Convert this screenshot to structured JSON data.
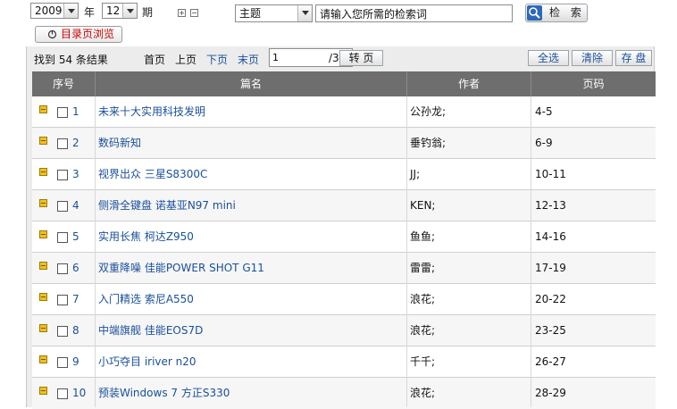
{
  "top": {
    "year_value": "2009",
    "year_unit": "年",
    "issue_value": "12",
    "issue_unit": "期",
    "expand_symbol": "+",
    "collapse_symbol": "−",
    "field_value": "主题",
    "search_placeholder": "请输入您所需的检索词",
    "search_label": "检 索",
    "catalog_label": "目录页浏览"
  },
  "nav": {
    "result_text": "找到 54 条结果",
    "first": "首页",
    "prev": "上页",
    "next": "下页",
    "last": "末页",
    "page_value": "1",
    "total": "/3",
    "go": "转 页",
    "select_all": "全选",
    "clear": "清除",
    "save": "存 盘"
  },
  "table": {
    "headers": {
      "index": "序号",
      "title": "篇名",
      "author": "作者",
      "pages": "页码"
    },
    "rows": [
      {
        "index": "1",
        "title": "未来十大实用科技发明",
        "author": "公孙龙;",
        "pages": "4-5"
      },
      {
        "index": "2",
        "title": "数码新知",
        "author": "垂钓翁;",
        "pages": "6-9"
      },
      {
        "index": "3",
        "title": "视界出众 三星S8300C",
        "author": "JJ;",
        "pages": "10-11"
      },
      {
        "index": "4",
        "title": "侧滑全键盘 诺基亚N97 mini",
        "author": "KEN;",
        "pages": "12-13"
      },
      {
        "index": "5",
        "title": "实用长焦 柯达Z950",
        "author": "鱼鱼;",
        "pages": "14-16"
      },
      {
        "index": "6",
        "title": "双重降噪 佳能POWER SHOT G11",
        "author": "雷雷;",
        "pages": "17-19"
      },
      {
        "index": "7",
        "title": "入门精选 索尼A550",
        "author": "浪花;",
        "pages": "20-22"
      },
      {
        "index": "8",
        "title": "中端旗舰 佳能EOS7D",
        "author": "浪花;",
        "pages": "23-25"
      },
      {
        "index": "9",
        "title": "小巧夺目 iriver n20",
        "author": "千千;",
        "pages": "26-27"
      },
      {
        "index": "10",
        "title": "预装Windows 7 方正S330",
        "author": "浪花;",
        "pages": "28-29"
      }
    ]
  },
  "colors": {
    "link": "#1a4f9c",
    "header_bg": "#6e6e6e",
    "accent_red": "#cc0000",
    "search_icon_bg": "#2d68b8"
  }
}
